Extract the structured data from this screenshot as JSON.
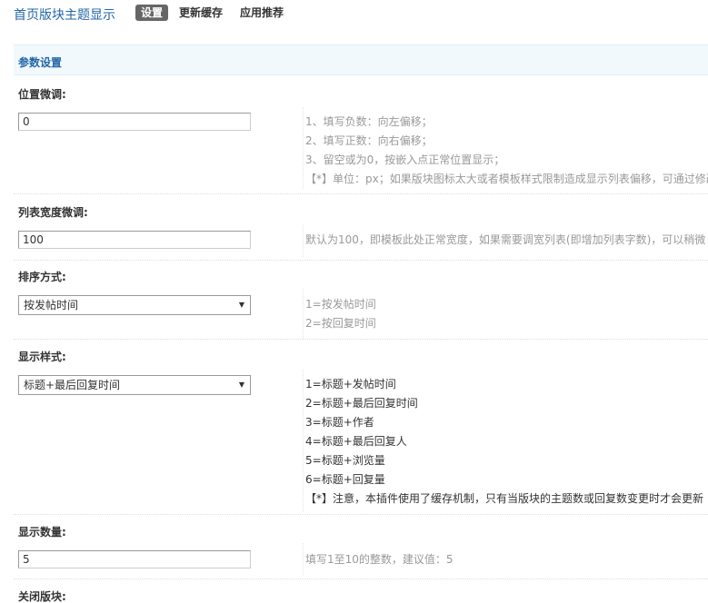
{
  "header": {
    "title": "首页版块主题显示",
    "tabs": [
      {
        "label": "设置",
        "active": true
      },
      {
        "label": "更新缓存",
        "active": false
      },
      {
        "label": "应用推荐",
        "active": false
      }
    ]
  },
  "section": {
    "title": "参数设置"
  },
  "settings": {
    "offset": {
      "label": "位置微调:",
      "value": "0",
      "help": [
        "1、填写负数：向左偏移；",
        "2、填写正数：向右偏移；",
        "3、留空或为0，按嵌入点正常位置显示；",
        "【*】单位：px；如果版块图标太大或者模板样式限制造成显示列表偏移，可通过修改"
      ]
    },
    "width": {
      "label": "列表宽度微调:",
      "value": "100",
      "help": [
        "默认为100，即模板此处正常宽度，如果需要调宽列表(即增加列表字数)，可以稍微"
      ]
    },
    "sort": {
      "label": "排序方式:",
      "selected": "按发帖时间",
      "help": [
        "1=按发帖时间",
        "2=按回复时间"
      ]
    },
    "style": {
      "label": "显示样式:",
      "selected": "标题+最后回复时间",
      "help": [
        "1=标题+发帖时间",
        "2=标题+最后回复时间",
        "3=标题+作者",
        "4=标题+最后回复人",
        "5=标题+浏览量",
        "6=标题+回复量",
        "【*】注意，本插件使用了缓存机制，只有当版块的主题数或回复数变更时才会更新"
      ]
    },
    "count": {
      "label": "显示数量:",
      "value": "5",
      "help": [
        "填写1至10的整数，建议值：5"
      ]
    },
    "close": {
      "label": "关闭版块:"
    }
  },
  "colors": {
    "accent": "#2366a8",
    "section_bg": "#f2f9fd",
    "help_text": "#999999",
    "active_tab_bg": "#666666"
  },
  "icons": {
    "select_arrow": "triangle-down-icon"
  }
}
